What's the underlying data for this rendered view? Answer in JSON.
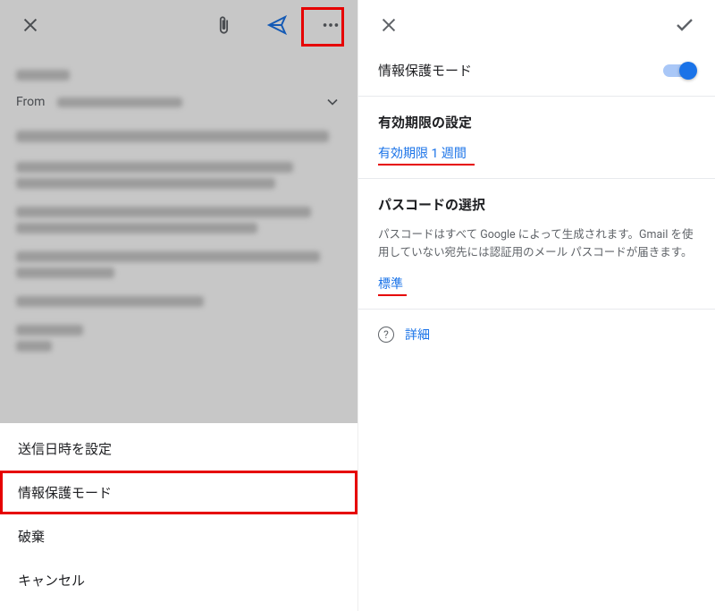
{
  "left": {
    "from_label": "From",
    "sheet": {
      "schedule": "送信日時を設定",
      "confidential": "情報保護モード",
      "discard": "破棄",
      "cancel": "キャンセル"
    }
  },
  "right": {
    "mode_label": "情報保護モード",
    "toggle_on": true,
    "expiry": {
      "title": "有効期限の設定",
      "value": "有効期限 1 週間"
    },
    "passcode": {
      "title": "パスコードの選択",
      "desc": "パスコードはすべて Google によって生成されます。Gmail を使用していない宛先には認証用のメール パスコードが届きます。",
      "value": "標準"
    },
    "details": "詳細"
  }
}
